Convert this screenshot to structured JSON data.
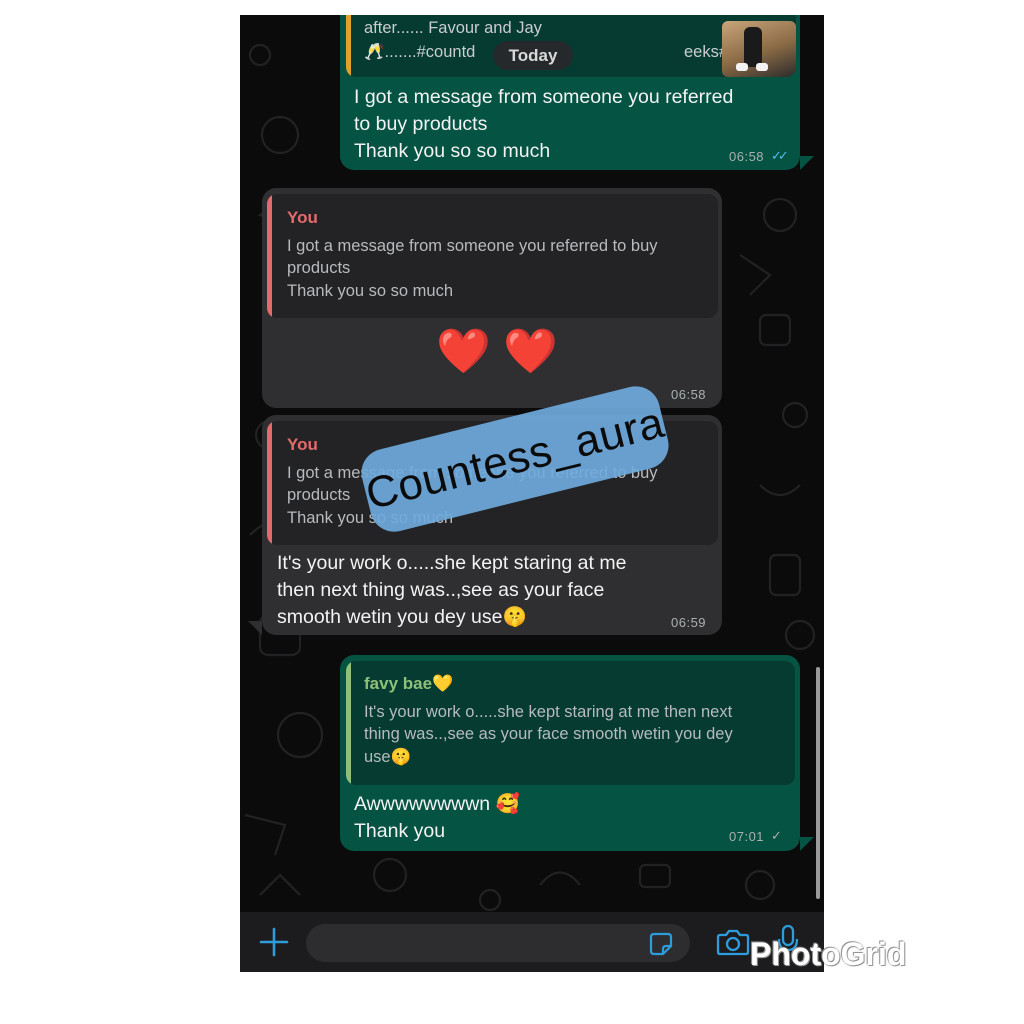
{
  "chat": {
    "date_chip": "Today",
    "top_quote_text_line1": "after...... Favour and Jay",
    "top_quote_text_line2": "🥂.......#countd",
    "top_quote_text_line2_end": "eeks#",
    "messages": [
      {
        "direction": "outgoing",
        "lines": [
          "I got a message from someone you referred",
          "to buy products",
          "Thank you so so much"
        ],
        "time": "06:58",
        "ticks": "✓✓",
        "tick_color": "#53bdeb"
      },
      {
        "direction": "incoming",
        "quote_author": "You",
        "quote_lines": [
          "I got a message from someone you referred to buy",
          "products",
          "Thank you so so much"
        ],
        "body": "❤️ ❤️",
        "time": "06:58"
      },
      {
        "direction": "incoming",
        "quote_author": "You",
        "quote_lines": [
          "I got a message from someone you referred to buy",
          "products",
          "Thank you so so much"
        ],
        "lines": [
          "It's your work o.....she kept staring at me",
          "then next thing was..,see as your face",
          "smooth wetin you dey use🤫"
        ],
        "time": "06:59"
      },
      {
        "direction": "outgoing",
        "quote_author": "favy bae💛",
        "quote_lines": [
          "It's your work o.....she kept staring at me then next",
          "thing was..,see as your face smooth wetin you dey",
          "use🤫"
        ],
        "lines": [
          "Awwwwwwwwn 🥰",
          "Thank you"
        ],
        "time": "07:01",
        "ticks": "✓",
        "tick_color": "#a9b1b0"
      }
    ]
  },
  "watermark": "Countess_aura",
  "app_badge": "PhotoGrid",
  "icons": {
    "add": "plus-icon",
    "sticker": "sticker-icon",
    "camera": "camera-icon",
    "mic": "microphone-icon"
  },
  "colors": {
    "outgoing_bubble": "#045343",
    "incoming_bubble": "#2f2f31",
    "accent_blue": "#2d9cdb",
    "you_author": "#e46b6b",
    "favy_author": "#8fc07a"
  }
}
